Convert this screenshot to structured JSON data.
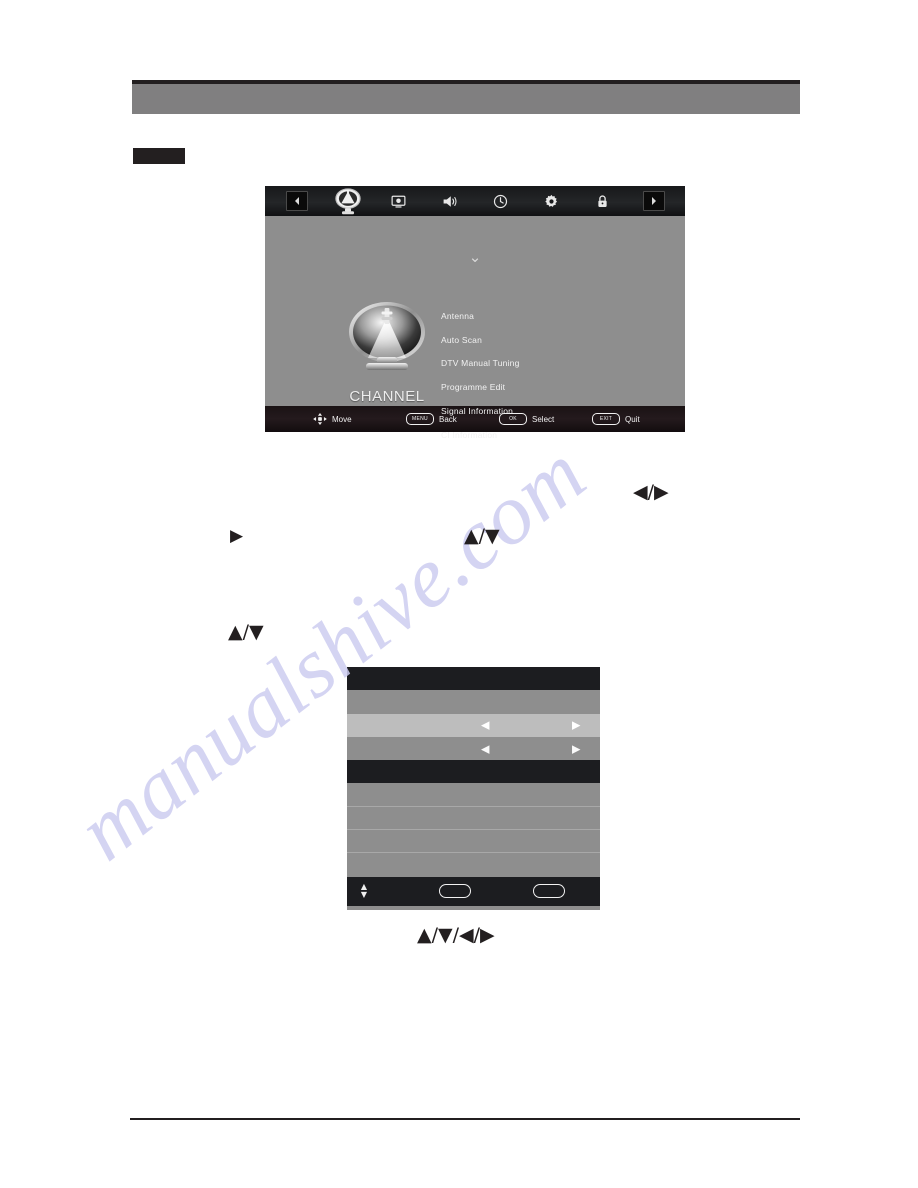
{
  "page": {
    "watermark": "manualshive.com",
    "header_bar_color": "#807f80",
    "accent_dark": "#231f20"
  },
  "annotations": {
    "glyph_left_right": "◀/▶",
    "glyph_right": "▶",
    "glyph_up_down_1": "▲/▼",
    "glyph_up_down_2": "▲/▼",
    "glyph_four_way": "▲/▼/◀/▶"
  },
  "osd_channel_menu": {
    "icon_bar": [
      {
        "name": "prev-arrow-icon",
        "icon": "left-arrow-boxed"
      },
      {
        "name": "channel-icon",
        "icon": "satellite-dish",
        "active": true
      },
      {
        "name": "picture-icon",
        "icon": "monitor"
      },
      {
        "name": "sound-icon",
        "icon": "speaker"
      },
      {
        "name": "time-icon",
        "icon": "clock"
      },
      {
        "name": "setup-icon",
        "icon": "gear"
      },
      {
        "name": "lock-icon",
        "icon": "padlock"
      },
      {
        "name": "next-arrow-icon",
        "icon": "right-arrow-boxed"
      }
    ],
    "scroll_hint": "⌄",
    "panel_label": "CHANNEL",
    "menu_items": [
      "Antenna",
      "Auto Scan",
      "DTV Manual Tuning",
      "Programme Edit",
      "Signal Information",
      "CI Information"
    ],
    "footer": [
      {
        "key": "",
        "label": "Move",
        "icon": "dpad-icon"
      },
      {
        "key": "MENU",
        "label": "Back",
        "icon": ""
      },
      {
        "key": "OK",
        "label": "Select",
        "icon": ""
      },
      {
        "key": "EXIT",
        "label": "Quit",
        "icon": ""
      }
    ]
  },
  "osd_settings_list": {
    "rows": [
      {
        "style": "dark",
        "label": "",
        "has_arrows": false
      },
      {
        "style": "mid",
        "label": "",
        "has_arrows": false
      },
      {
        "style": "light",
        "label": "",
        "has_arrows": true,
        "arrow_left": "◀",
        "arrow_right": "▶"
      },
      {
        "style": "mid",
        "label": "",
        "has_arrows": true,
        "arrow_left": "◀",
        "arrow_right": "▶"
      },
      {
        "style": "dark",
        "label": "",
        "has_arrows": false
      },
      {
        "style": "mid",
        "label": "",
        "has_arrows": false
      },
      {
        "style": "mid",
        "label": "",
        "has_arrows": false
      },
      {
        "style": "mid",
        "label": "",
        "has_arrows": false
      },
      {
        "style": "mid",
        "label": "",
        "has_arrows": false
      }
    ],
    "footer": {
      "updown_up": "▲",
      "updown_down": "▼",
      "button_1_label": "",
      "button_2_label": ""
    }
  }
}
